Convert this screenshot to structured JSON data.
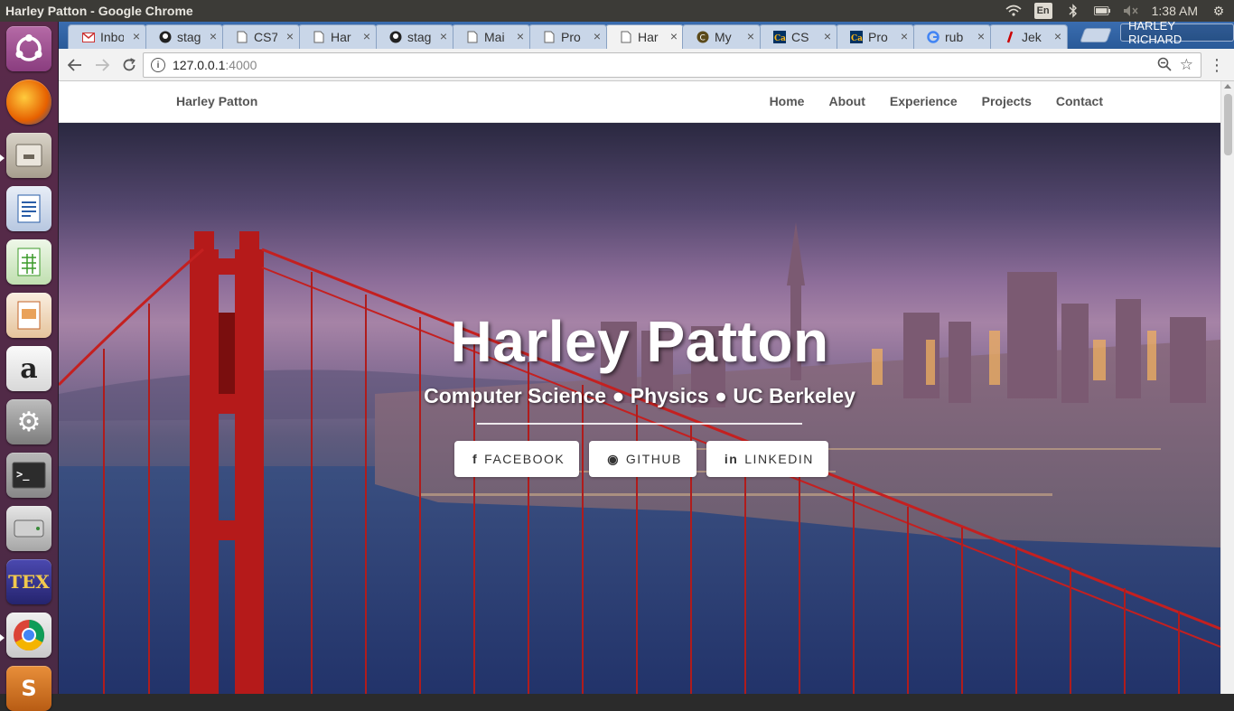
{
  "os_panel": {
    "window_title": "Harley Patton - Google Chrome",
    "keyboard_layout": "En",
    "clock": "1:38 AM",
    "icons": [
      "wifi-icon",
      "bluetooth-icon",
      "battery-icon",
      "volume-muted-icon",
      "gear-icon"
    ]
  },
  "launcher": {
    "items": [
      "ubuntu-dash",
      "firefox",
      "files",
      "libreoffice-writer",
      "libreoffice-calc",
      "libreoffice-impress",
      "amazon",
      "system-settings",
      "terminal",
      "disk",
      "texmaker",
      "chrome",
      "sublime-text"
    ]
  },
  "browser": {
    "tabs": [
      {
        "label": "Inbo",
        "icon": "gmail-icon"
      },
      {
        "label": "stag",
        "icon": "github-icon"
      },
      {
        "label": "CS7",
        "icon": "page-icon"
      },
      {
        "label": "Har",
        "icon": "page-icon"
      },
      {
        "label": "stag",
        "icon": "github-icon"
      },
      {
        "label": "Mai",
        "icon": "page-icon"
      },
      {
        "label": "Pro",
        "icon": "page-icon"
      },
      {
        "label": "Har",
        "icon": "page-icon",
        "active": true
      },
      {
        "label": "My",
        "icon": "c-icon"
      },
      {
        "label": "CS",
        "icon": "cal-icon"
      },
      {
        "label": "Pro",
        "icon": "cal-icon"
      },
      {
        "label": "rub",
        "icon": "google-icon"
      },
      {
        "label": "Jek",
        "icon": "jekyll-icon"
      }
    ],
    "profile_name": "HARLEY RICHARD",
    "url_host": "127.0.0.1",
    "url_port": ":4000"
  },
  "site": {
    "brand": "Harley Patton",
    "nav": [
      "Home",
      "About",
      "Experience",
      "Projects",
      "Contact"
    ],
    "hero_title": "Harley Patton",
    "hero_subtitle": "Computer Science ● Physics ● UC Berkeley",
    "buttons": [
      {
        "label": "FACEBOOK",
        "icon": "f"
      },
      {
        "label": "GITHUB",
        "icon": "◉"
      },
      {
        "label": "LINKEDIN",
        "icon": "in"
      }
    ]
  }
}
